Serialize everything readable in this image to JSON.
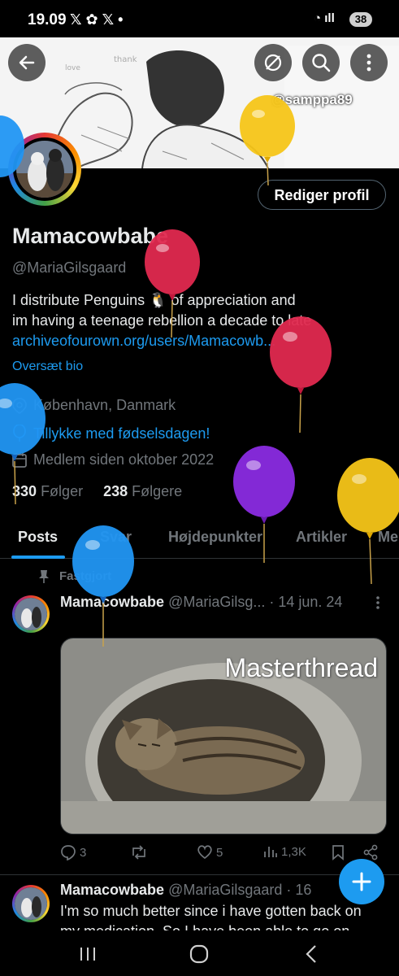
{
  "status_bar": {
    "time": "19.09",
    "notification_icons": "𝕏 ✿ 𝕏 •",
    "battery": "38"
  },
  "banner": {
    "watermark": "@samppa89"
  },
  "profile": {
    "edit_button": "Rediger profil",
    "name": "Mamacowbabe",
    "handle": "@MariaGilsgaard",
    "bio_line1": "I distribute Penguins 🐧 of appreciation and",
    "bio_line2": "im having a teenage rebellion a decade to late",
    "bio_link": "archiveofourown.org/users/Mamacowb...",
    "translate_bio": "Oversæt bio",
    "location": "København, Danmark",
    "birthday": "Tillykke med fødselsdagen!",
    "joined": "Medlem siden oktober 2022",
    "following_count": "330",
    "following_label": "Følger",
    "followers_count": "238",
    "followers_label": "Følgere"
  },
  "tabs": [
    "Posts",
    "Svar",
    "Højdepunkter",
    "Artikler",
    "Me"
  ],
  "pinned_label": "Fastgjort",
  "post1": {
    "name": "Mamacowbabe",
    "handle": "@MariaGilsg...",
    "date": "· 14 jun. 24",
    "media_title": "Masterthread",
    "replies": "3",
    "reposts": "",
    "likes": "5",
    "views": "1,3K"
  },
  "post2": {
    "name": "Mamacowbabe",
    "handle": "@MariaGilsgaard",
    "date": "· 16",
    "text_line1": "I'm so much better since i have gotten back on",
    "text_line2": "my medication. So I have been able to go on"
  },
  "colors": {
    "accent": "#1d9bf0",
    "background": "#000000",
    "muted": "#71767b",
    "balloon_red": "#e0294f",
    "balloon_yellow": "#f5c518",
    "balloon_purple": "#8a2be2",
    "balloon_blue": "#2196f3"
  }
}
